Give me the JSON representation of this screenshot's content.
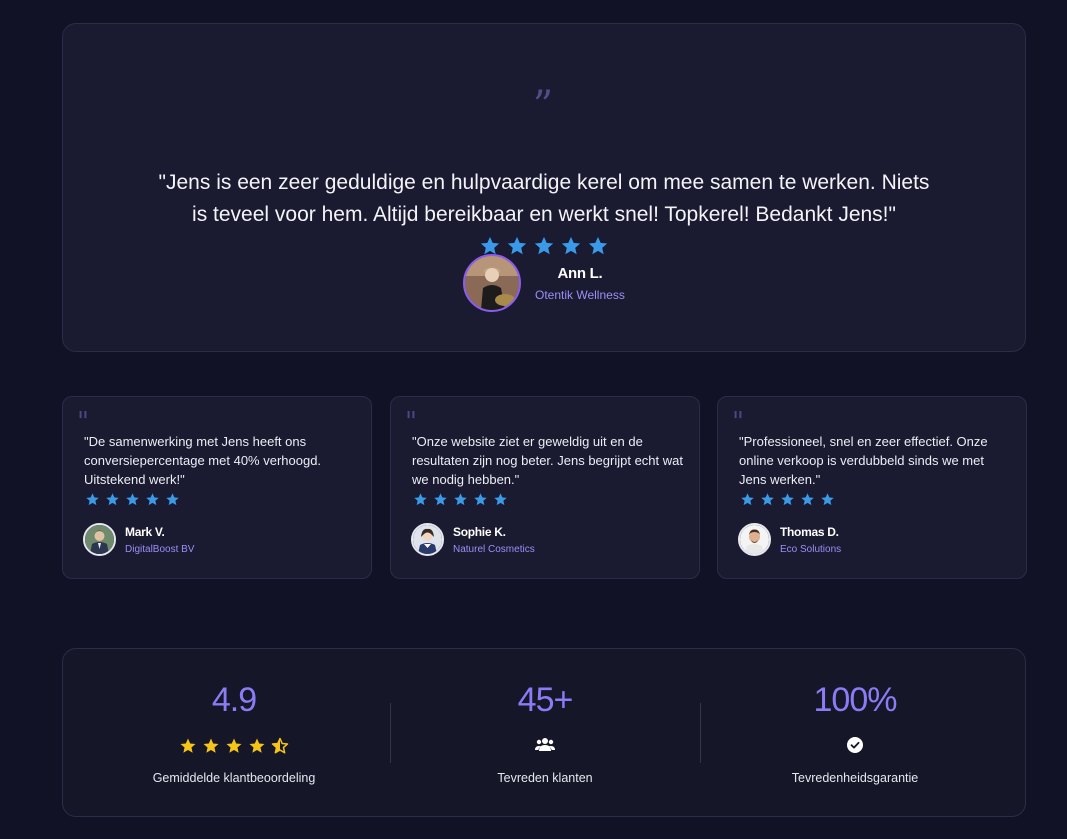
{
  "featured": {
    "quote_mark": "”",
    "quote": "\"Jens is een zeer geduldige en hulpvaardige kerel om mee samen te werken. Niets is teveel voor hem. Altijd bereikbaar en werkt snel! Topkerel! Bedankt Jens!\"",
    "rating": 5,
    "author": "Ann L.",
    "company": "Otentik Wellness"
  },
  "testimonials": [
    {
      "quote_mark": "\"",
      "quote": "\"De samenwerking met Jens heeft ons conversiepercentage met 40% verhoogd. Uitstekend werk!\"",
      "rating": 5,
      "author": "Mark V.",
      "company": "DigitalBoost BV"
    },
    {
      "quote_mark": "\"",
      "quote": "\"Onze website ziet er geweldig uit en de resultaten zijn nog beter. Jens begrijpt echt wat we nodig hebben.\"",
      "rating": 5,
      "author": "Sophie K.",
      "company": "Naturel Cosmetics"
    },
    {
      "quote_mark": "\"",
      "quote": "\"Professioneel, snel en zeer effectief. Onze online verkoop is verdubbeld sinds we met Jens werken.\"",
      "rating": 5,
      "author": "Thomas D.",
      "company": "Eco Solutions"
    }
  ],
  "stats": [
    {
      "value": "4.9",
      "label": "Gemiddelde klantbeoordeling",
      "icon": "star-rating-icon",
      "rating": 4.5
    },
    {
      "value": "45+",
      "label": "Tevreden klanten",
      "icon": "users-icon"
    },
    {
      "value": "100%",
      "label": "Tevredenheidsgarantie",
      "icon": "check-circle-icon"
    }
  ],
  "colors": {
    "background": "#121226",
    "card": "#1a1a30",
    "accent": "#8b7cf6",
    "company_text": "#9d8ef8",
    "star_blue": "#3b9ae8",
    "star_gold": "#f5c518"
  }
}
